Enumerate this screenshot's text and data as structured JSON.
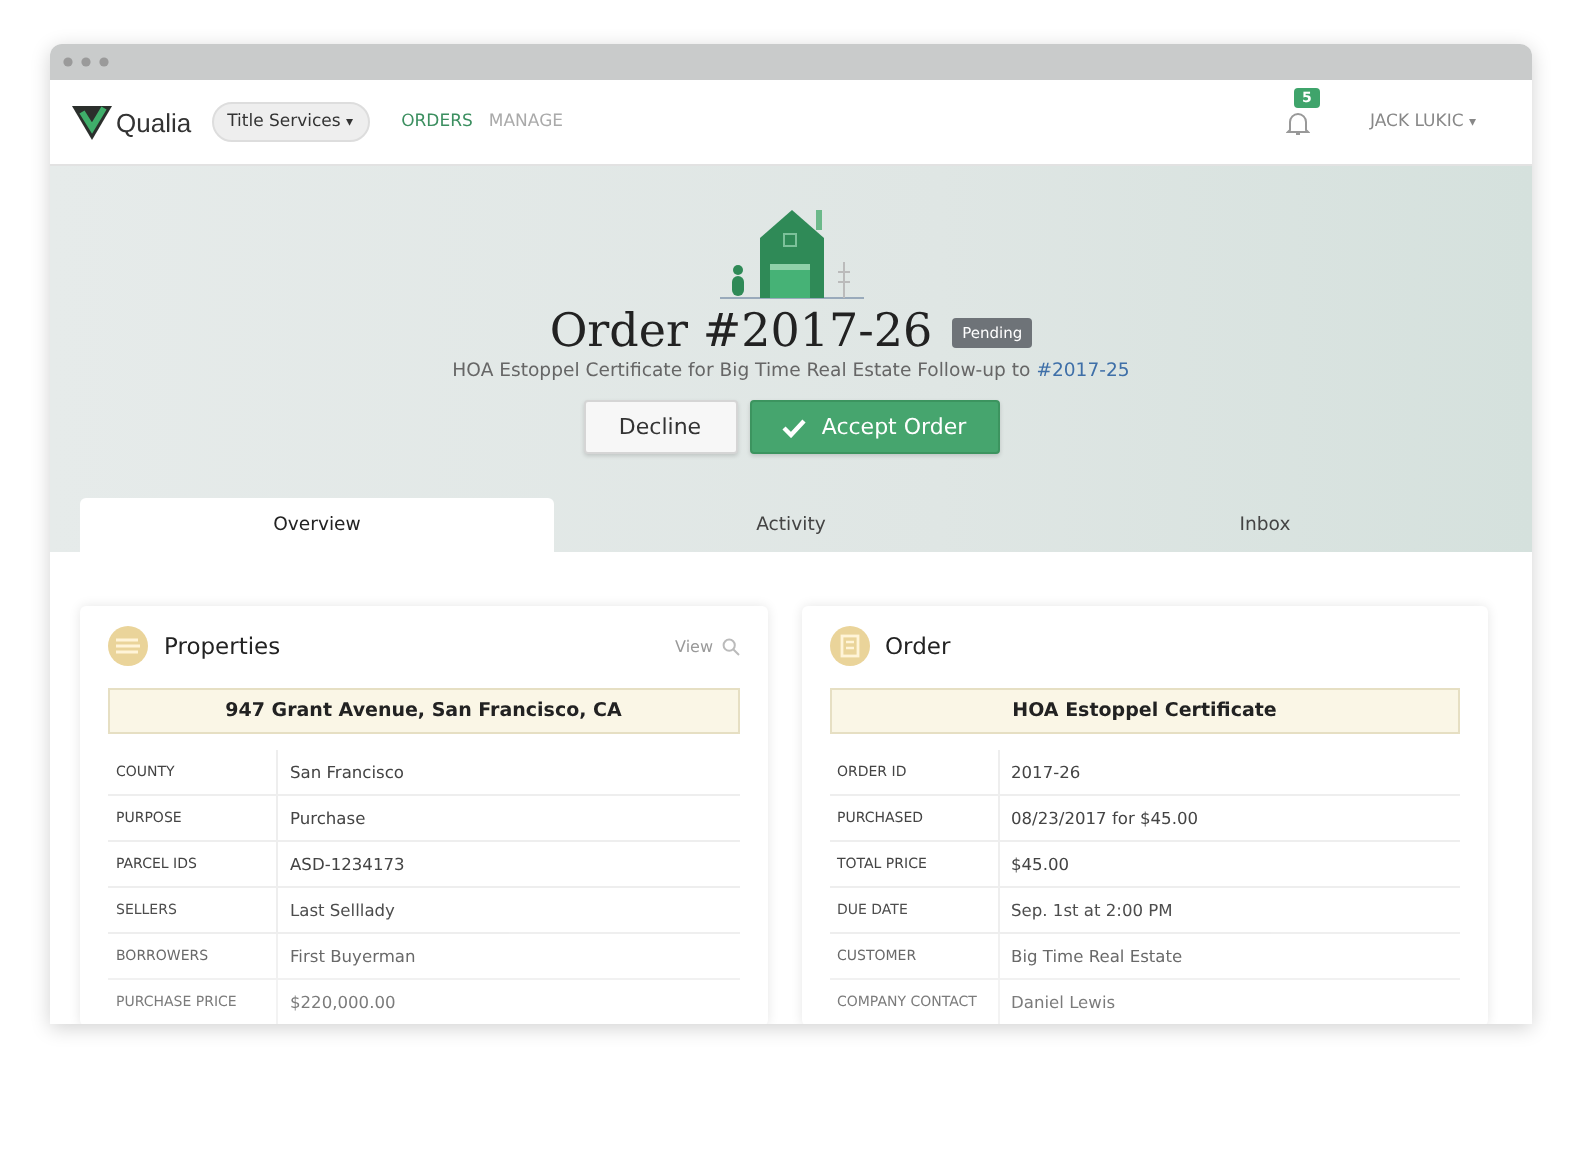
{
  "brand": {
    "name": "Qualia"
  },
  "workspace": {
    "label": "Title Services",
    "caret": "▾"
  },
  "nav": [
    {
      "label": "ORDERS",
      "selected": true
    },
    {
      "label": "MANAGE",
      "selected": false
    }
  ],
  "notifications": {
    "count": "5"
  },
  "user": {
    "name": "JACK LUKIC",
    "caret": "▾"
  },
  "order": {
    "title": "Order #2017-26",
    "status": "Pending",
    "subtitle": "HOA Estoppel Certificate for Big Time Real Estate Follow-up to ",
    "link": "#2017-25"
  },
  "actions": [
    {
      "kind": "secondary",
      "label": "Decline"
    },
    {
      "kind": "primary",
      "label": "Accept Order"
    }
  ],
  "tabs": [
    {
      "label": "Overview",
      "selected": true
    },
    {
      "label": "Activity",
      "selected": false
    },
    {
      "label": "Inbox",
      "selected": false
    }
  ],
  "cards": [
    {
      "kind": "properties",
      "title": "Properties",
      "action": "View",
      "banner": "947 Grant Avenue, San Francisco, CA",
      "rows": [
        {
          "label": "COUNTY",
          "value": "San Francisco"
        },
        {
          "label": "PURPOSE",
          "value": "Purchase"
        },
        {
          "label": "PARCEL IDS",
          "value": "ASD-1234173"
        },
        {
          "label": "SELLERS",
          "value": "Last Selllady"
        },
        {
          "label": "BORROWERS",
          "value": "First Buyerman"
        },
        {
          "label": "PURCHASE PRICE",
          "value": "$220,000.00"
        }
      ]
    },
    {
      "kind": "order",
      "title": "Order",
      "banner": "HOA Estoppel Certificate",
      "rows": [
        {
          "label": "ORDER ID",
          "value": "2017-26"
        },
        {
          "label": "PURCHASED",
          "value": "08/23/2017 for $45.00"
        },
        {
          "label": "TOTAL PRICE",
          "value": "$45.00"
        },
        {
          "label": "DUE DATE",
          "value": "Sep. 1st at 2:00 PM"
        },
        {
          "label": "CUSTOMER",
          "value": "Big Time Real Estate"
        },
        {
          "label": "COMPANY CONTACT",
          "value": "Daniel Lewis"
        }
      ]
    }
  ]
}
